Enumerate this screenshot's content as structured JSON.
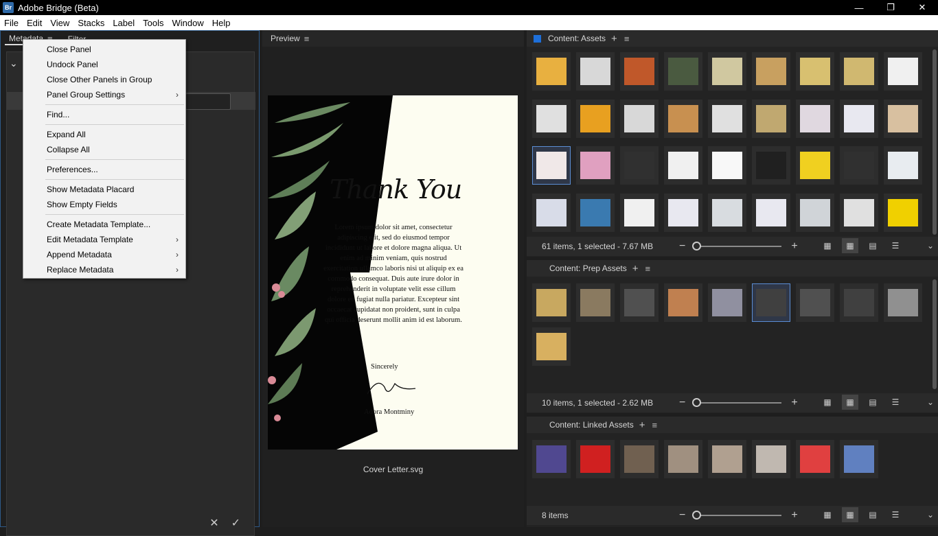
{
  "window": {
    "title": "Adobe Bridge (Beta)",
    "app_icon": "Br",
    "minimize": "—",
    "restore": "❐",
    "close": "✕"
  },
  "menubar": [
    "File",
    "Edit",
    "View",
    "Stacks",
    "Label",
    "Tools",
    "Window",
    "Help"
  ],
  "metadata_panel": {
    "tabs": [
      {
        "label": "Metadata",
        "active": true
      },
      {
        "label": "Filter",
        "active": false
      }
    ],
    "menu_icon": "≡",
    "cancel_icon": "✕",
    "apply_icon": "✓"
  },
  "context_menu": {
    "items": [
      {
        "label": "Close Panel",
        "submenu": false
      },
      {
        "label": "Undock Panel",
        "submenu": false
      },
      {
        "label": "Close Other Panels in Group",
        "submenu": false
      },
      {
        "label": "Panel Group Settings",
        "submenu": true
      },
      {
        "separator": true
      },
      {
        "label": "Find...",
        "submenu": false
      },
      {
        "separator": true
      },
      {
        "label": "Expand All",
        "submenu": false
      },
      {
        "label": "Collapse All",
        "submenu": false
      },
      {
        "separator": true
      },
      {
        "label": "Preferences...",
        "submenu": false
      },
      {
        "separator": true
      },
      {
        "label": "Show Metadata Placard",
        "submenu": false
      },
      {
        "label": "Show Empty Fields",
        "submenu": false
      },
      {
        "separator": true
      },
      {
        "label": "Create Metadata Template...",
        "submenu": false
      },
      {
        "label": "Edit Metadata Template",
        "submenu": true
      },
      {
        "label": "Append Metadata",
        "submenu": true
      },
      {
        "label": "Replace Metadata",
        "submenu": true
      }
    ],
    "submenu_arrow": "›"
  },
  "preview_panel": {
    "tab_label": "Preview",
    "menu_icon": "≡",
    "caption": "Cover Letter.svg",
    "doc": {
      "heading": "Thank You",
      "body": "Lorem ipsum dolor sit amet, consectetur adipiscing elit, sed do eiusmod tempor incididunt ut labore et dolore magna aliqua. Ut enim ad minim veniam, quis nostrud exercitation ullamco laboris nisi ut aliquip ex ea commodo consequat. Duis aute irure dolor in reprehenderit in voluptate velit esse cillum dolore eu fugiat nulla pariatur. Excepteur sint occaecat cupidatat non proident, sunt in culpa qui officia deserunt mollit anim id est laborum.",
      "closing": "Sincerely",
      "name": "Adora Montminy"
    }
  },
  "content_panels": [
    {
      "title": "Content: Assets",
      "status": "61 items, 1 selected - 7.67 MB",
      "selected_index": 18,
      "thumbs": [
        "#e8b040",
        "#d8d8d8",
        "#c0582a",
        "#4a5a40",
        "#d0c8a0",
        "#c8a060",
        "#d8c070",
        "#d0b870",
        "#f0f0f0",
        "#e0e0e0",
        "#e8a020",
        "#d8d8d8",
        "#c89050",
        "#e0e0e0",
        "#c0a870",
        "#e0d8e0",
        "#e8e8f0",
        "#d8c0a0",
        "#f0e8e8",
        "#e0a0c0",
        "#303030",
        "#f0f0f0",
        "#f8f8f8",
        "#202020",
        "#f0d020",
        "#303030",
        "#e8ecf0",
        "#d8dce8",
        "#3a7ab0",
        "#f0f0f0",
        "#e8e8f0",
        "#d8dce0",
        "#e8e8f0",
        "#d0d4d8",
        "#e0e0e0",
        "#f0d000"
      ]
    },
    {
      "title": "Content: Prep Assets",
      "status": "10 items, 1 selected - 2.62 MB",
      "selected_index": 5,
      "thumbs": [
        "#c8a860",
        "#8a7a60",
        "#505050",
        "#c08050",
        "#9090a0",
        "#404040",
        "#505050",
        "#404040",
        "#909090",
        "#d8b060"
      ]
    },
    {
      "title": "Content: Linked Assets",
      "status": "8 items",
      "selected_index": -1,
      "thumbs": [
        "#504890",
        "#d02020",
        "#706050",
        "#a09080",
        "#b0a090",
        "#c0b8b0",
        "#e04040",
        "#6080c0"
      ]
    }
  ],
  "icons": {
    "plus": "+",
    "minus": "−",
    "menu": "≡",
    "chevron_down": "⌄"
  }
}
